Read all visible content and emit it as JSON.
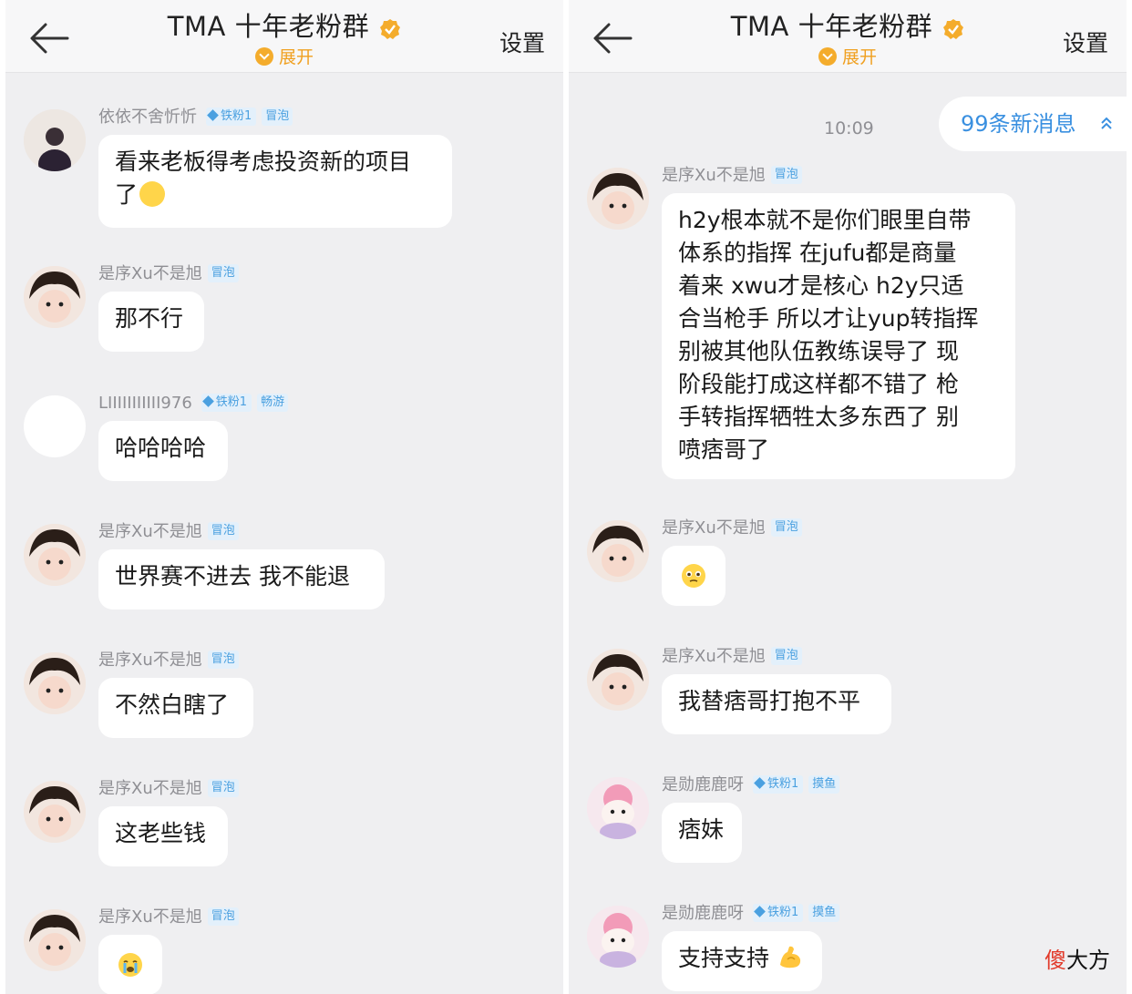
{
  "left_panel": {
    "header": {
      "title": "TMA 十年老粉群",
      "expand_label": "展开",
      "settings_label": "设置"
    },
    "messages": [
      {
        "sender": "依依不舍忻忻",
        "level": "铁粉1",
        "tag": "冒泡",
        "text": "看来老板得考虑投资新的项目",
        "text2": "了"
      },
      {
        "sender": "是序Xu不是旭",
        "tag": "冒泡",
        "text": "那不行"
      },
      {
        "sender": "LIIIIIIIIIII976",
        "level": "铁粉1",
        "tag": "畅游",
        "text": "哈哈哈哈"
      },
      {
        "sender": "是序Xu不是旭",
        "tag": "冒泡",
        "text": "世界赛不进去 我不能退"
      },
      {
        "sender": "是序Xu不是旭",
        "tag": "冒泡",
        "text": "不然白瞎了"
      },
      {
        "sender": "是序Xu不是旭",
        "tag": "冒泡",
        "text": "这老些钱"
      },
      {
        "sender": "是序Xu不是旭",
        "tag": "冒泡",
        "text": ""
      }
    ]
  },
  "right_panel": {
    "header": {
      "title": "TMA 十年老粉群",
      "expand_label": "展开",
      "settings_label": "设置"
    },
    "time": "10:09",
    "new_messages": "99条新消息",
    "messages": [
      {
        "sender": "是序Xu不是旭",
        "tag": "冒泡",
        "lines": [
          "h2y根本就不是你们眼里自带",
          "体系的指挥 在jufu都是商量",
          "着来 xwu才是核心 h2y只适",
          "合当枪手 所以才让yup转指挥",
          "别被其他队伍教练误导了 现",
          "阶段能打成这样都不错了 枪",
          "手转指挥牺牲太多东西了 别",
          "喷痞哥了"
        ]
      },
      {
        "sender": "是序Xu不是旭",
        "tag": "冒泡",
        "text": ""
      },
      {
        "sender": "是序Xu不是旭",
        "tag": "冒泡",
        "text": "我替痞哥打抱不平"
      },
      {
        "sender": "是勋鹿鹿呀",
        "level": "铁粉1",
        "tag": "摸鱼",
        "text": "痞妹"
      },
      {
        "sender": "是勋鹿鹿呀",
        "level": "铁粉1",
        "tag": "摸鱼",
        "text": "支持支持"
      }
    ]
  },
  "watermark": {
    "first_char": "傻",
    "rest": "大方"
  },
  "icons": [
    "back-arrow-icon",
    "verified-badge-icon",
    "expand-chevron-icon",
    "double-chevron-up-icon",
    "face-emoji-icon",
    "muscle-emoji-icon"
  ],
  "colors": {
    "accent_blue": "#3a90e0",
    "expand_orange": "#f0a020",
    "badge_bg": "#e3f0fb",
    "panel_bg": "#efeff1"
  }
}
